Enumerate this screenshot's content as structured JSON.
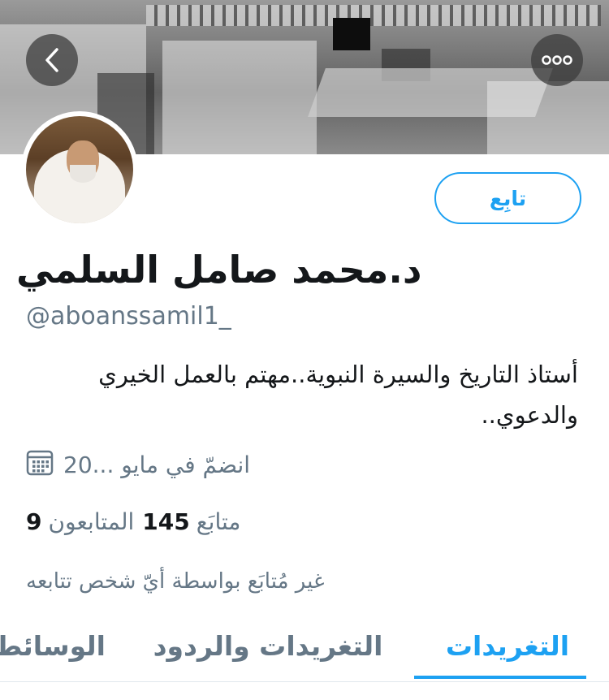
{
  "header": {
    "back_icon": "chevron-left-icon",
    "more_icon": "more-horizontal-icon"
  },
  "profile": {
    "follow_label": "تابِع",
    "display_name": "د.محمد صامل السلمي",
    "handle": "@aboanssamil1_",
    "bio": "أستاذ التاريخ والسيرة النبوية..مهتم بالعمل الخيري والدعوي..",
    "joined": "انضمّ في مايو ...20",
    "joined_icon": "calendar-icon",
    "following_count": "145",
    "following_label": "متابَع",
    "followers_count": "9",
    "followers_label": "المتابعون",
    "not_followed_text": "غير مُتابَع بواسطة أيّ شخص تتابعه"
  },
  "tabs": [
    {
      "label": "التغريدات",
      "active": true
    },
    {
      "label": "التغريدات والردود",
      "active": false
    },
    {
      "label": "الوسائط",
      "active": false
    }
  ],
  "colors": {
    "accent": "#1da1f2",
    "text": "#14171a",
    "secondary": "#657786"
  }
}
